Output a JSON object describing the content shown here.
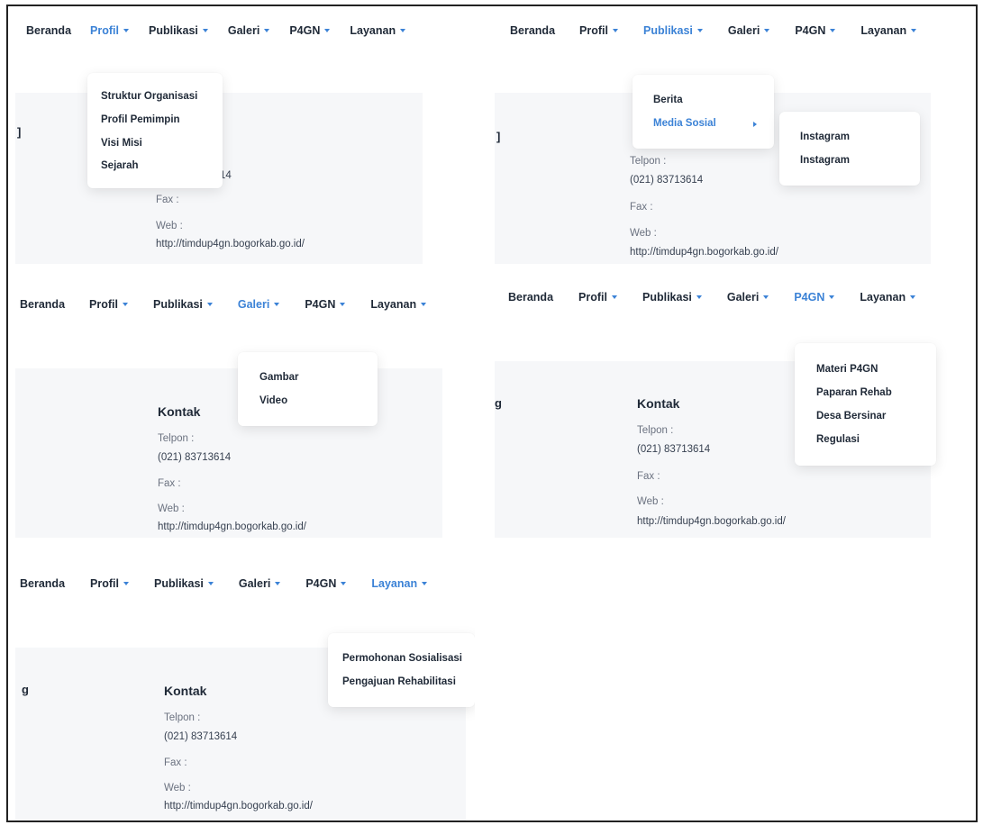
{
  "nav": {
    "beranda": "Beranda",
    "profil": "Profil",
    "publikasi": "Publikasi",
    "galeri": "Galeri",
    "p4gn": "P4GN",
    "layanan": "Layanan"
  },
  "accent_color": "#3b82d6",
  "caret_icon": "caret-down-icon",
  "contact": {
    "title": "Kontak",
    "telpon_label": "Telpon :",
    "telpon_value": "(021) 83713614",
    "fax_label": "Fax :",
    "web_label": "Web :",
    "web_value": "http://timdup4gn.bogorkab.go.id/",
    "partial_p1_phone": "14",
    "partial_p2_web": "http://timdup4gn.bogorkab.go.id/",
    "partial_left_1": "]",
    "partial_left_2": "g"
  },
  "dropdowns": {
    "profil": [
      "Struktur Organisasi",
      "Profil Pemimpin",
      "Visi Misi",
      "Sejarah"
    ],
    "publikasi": [
      "Berita",
      "Media Sosial"
    ],
    "media_sosial": [
      "Instagram",
      "Instagram"
    ],
    "galeri": [
      "Gambar",
      "Video"
    ],
    "p4gn": [
      "Materi P4GN",
      "Paparan Rehab",
      "Desa Bersinar",
      "Regulasi"
    ],
    "layanan": [
      "Permohonan Sosialisasi",
      "Pengajuan Rehabilitasi"
    ]
  }
}
